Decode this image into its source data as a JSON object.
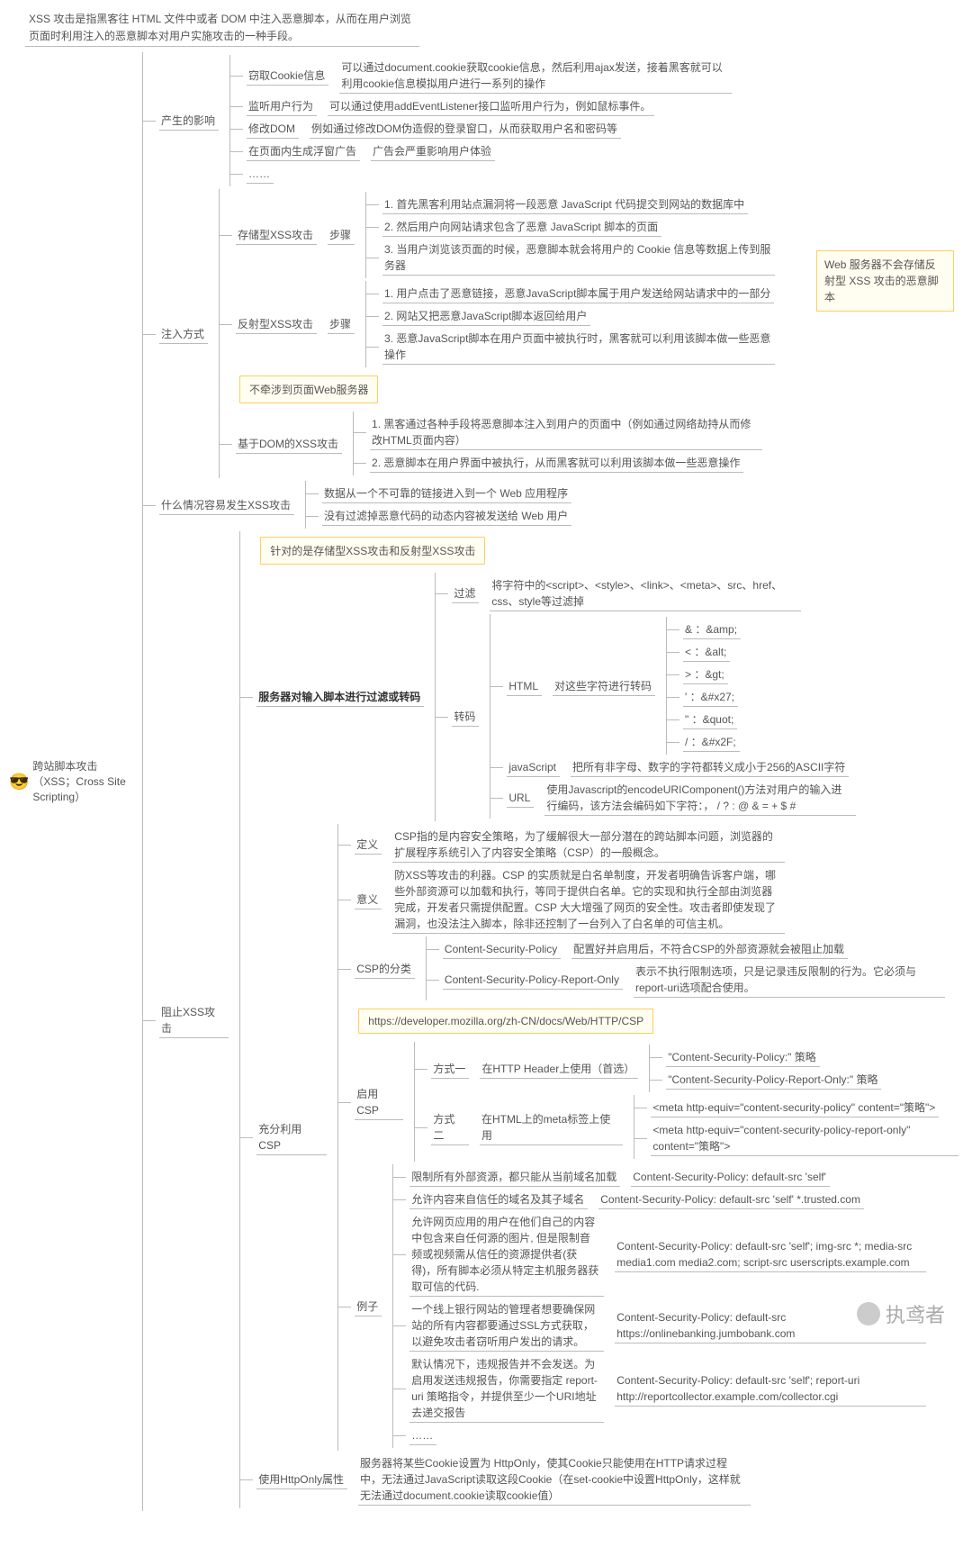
{
  "root": {
    "emoji": "😎",
    "title": "跨站脚本攻击（XSS；Cross Site Scripting）"
  },
  "intro": "XSS 攻击是指黑客往 HTML 文件中或者 DOM 中注入恶意脚本，从而在用户浏览页面时利用注入的恶意脚本对用户实施攻击的一种手段。",
  "impact": {
    "label": "产生的影响",
    "cookie_k": "窃取Cookie信息",
    "cookie_v": "可以通过document.cookie获取cookie信息，然后利用ajax发送，接着黑客就可以利用cookie信息模拟用户进行一系列的操作",
    "listen_k": "监听用户行为",
    "listen_v": "可以通过使用addEventListener接口监听用户行为，例如鼠标事件。",
    "dom_k": "修改DOM",
    "dom_v": "例如通过修改DOM伪造假的登录窗口，从而获取用户名和密码等",
    "ad_k": "在页面内生成浮窗广告",
    "ad_v": "广告会严重影响用户体验",
    "etc": "……"
  },
  "inject": {
    "label": "注入方式",
    "stored": "存储型XSS攻击",
    "reflected": "反射型XSS攻击",
    "dom": "基于DOM的XSS攻击",
    "steps": "步骤",
    "stored_s1": "1. 首先黑客利用站点漏洞将一段恶意 JavaScript 代码提交到网站的数据库中",
    "stored_s2": "2. 然后用户向网站请求包含了恶意 JavaScript 脚本的页面",
    "stored_s3": "3. 当用户浏览该页面的时候，恶意脚本就会将用户的 Cookie 信息等数据上传到服务器",
    "refl_s1": "1. 用户点击了恶意链接，恶意JavaScript脚本属于用户发送给网站请求中的一部分",
    "refl_s2": "2. 网站又把恶意JavaScript脚本返回给用户",
    "refl_s3": "3. 恶意JavaScript脚本在用户页面中被执行时，黑客就可以利用该脚本做一些恶意操作",
    "dom_s1": "1. 黑客通过各种手段将恶意脚本注入到用户的页面中（例如通过网络劫持从而修改HTML页面内容）",
    "dom_s2": "2. 恶意脚本在用户界面中被执行，从而黑客就可以利用该脚本做一些恶意操作",
    "note_noserver": "不牵涉到页面Web服务器",
    "side_note": "Web 服务器不会存储反射型 XSS 攻击的恶意脚本"
  },
  "when": {
    "label": "什么情况容易发生XSS攻击",
    "a": "数据从一个不可靠的链接进入到一个 Web 应用程序",
    "b": "没有过滤掉恶意代码的动态内容被发送给 Web 用户"
  },
  "prevent": {
    "label": "阻止XSS攻击",
    "server": "服务器对输入脚本进行过滤或转码",
    "server_note": "针对的是存储型XSS攻击和反射型XSS攻击",
    "filter": "过滤",
    "filter_v": "将字符中的<script>、<style>、<link>、<meta>、src、href、css、style等过滤掉",
    "encode": "转码",
    "html": "HTML",
    "html_v": "对这些字符进行转码",
    "amp": "& ：&amp;",
    "lt": "< ：&alt;",
    "gt": "> ：&gt;",
    "ap": "' ：&#x27;",
    "qt": "\" ：&quot;",
    "sl": "/ ：&#x2F;",
    "js": "javaScript",
    "js_v": "把所有非字母、数字的字符都转义成小于256的ASCII字符",
    "url": "URL",
    "url_v": "使用Javascript的encodeURIComponent()方法对用户的输入进行编码，该方法会编码如下字符：，  /  ?  :  @  &  =  +  $  #",
    "csp": "充分利用CSP",
    "csp_def": "定义",
    "csp_def_v": "CSP指的是内容安全策略，为了缓解很大一部分潜在的跨站脚本问题，浏览器的扩展程序系统引入了内容安全策略（CSP）的一般概念。",
    "csp_sig": "意义",
    "csp_sig_v": "防XSS等攻击的利器。CSP 的实质就是白名单制度，开发者明确告诉客户端，哪些外部资源可以加载和执行，等同于提供白名单。它的实现和执行全部由浏览器完成，开发者只需提供配置。CSP 大大增强了网页的安全性。攻击者即使发现了漏洞，也没法注入脚本，除非还控制了一台列入了白名单的可信主机。",
    "csp_cat": "CSP的分类",
    "csp_cat_a": "Content-Security-Policy",
    "csp_cat_a_v": "配置好并启用后，不符合CSP的外部资源就会被阻止加载",
    "csp_cat_b": "Content-Security-Policy-Report-Only",
    "csp_cat_b_v": "表示不执行限制选项，只是记录违反限制的行为。它必须与report-uri选项配合使用。",
    "csp_enable": "启用CSP",
    "csp_enable_url": "https://developer.mozilla.org/zh-CN/docs/Web/HTTP/CSP",
    "way1": "方式一",
    "way1_v": "在HTTP Header上使用（首选）",
    "way1_a": "\"Content-Security-Policy:\" 策略",
    "way1_b": "\"Content-Security-Policy-Report-Only:\" 策略",
    "way2": "方式二",
    "way2_v": "在HTML上的meta标签上使用",
    "way2_a": "<meta http-equiv=\"content-security-policy\" content=\"策略\">",
    "way2_b": "<meta http-equiv=\"content-security-policy-report-only\" content=\"策略\">",
    "eg": "例子",
    "eg1_k": "限制所有外部资源，都只能从当前域名加载",
    "eg1_v": "Content-Security-Policy: default-src 'self'",
    "eg2_k": "允许内容来自信任的域名及其子域名",
    "eg2_v": "Content-Security-Policy: default-src 'self' *.trusted.com",
    "eg3_k": "允许网页应用的用户在他们自己的内容中包含来自任何源的图片, 但是限制音频或视频需从信任的资源提供者(获得)，所有脚本必须从特定主机服务器获取可信的代码.",
    "eg3_v": "Content-Security-Policy: default-src 'self'; img-src *; media-src media1.com media2.com; script-src userscripts.example.com",
    "eg4_k": "一个线上银行网站的管理者想要确保网站的所有内容都要通过SSL方式获取，以避免攻击者窃听用户发出的请求。",
    "eg4_v": "Content-Security-Policy: default-src https://onlinebanking.jumbobank.com",
    "eg5_k": "默认情况下，违规报告并不会发送。为启用发送违规报告，你需要指定 report-uri 策略指令，并提供至少一个URI地址去递交报告",
    "eg5_v": "Content-Security-Policy: default-src 'self'; report-uri http://reportcollector.example.com/collector.cgi",
    "etc": "……",
    "httponly": "使用HttpOnly属性",
    "httponly_v": "服务器将某些Cookie设置为 HttpOnly，使其Cookie只能使用在HTTP请求过程中，无法通过JavaScript读取这段Cookie（在set-cookie中设置HttpOnly，这样就无法通过document.cookie读取cookie值）"
  },
  "watermark": "执鸢者"
}
